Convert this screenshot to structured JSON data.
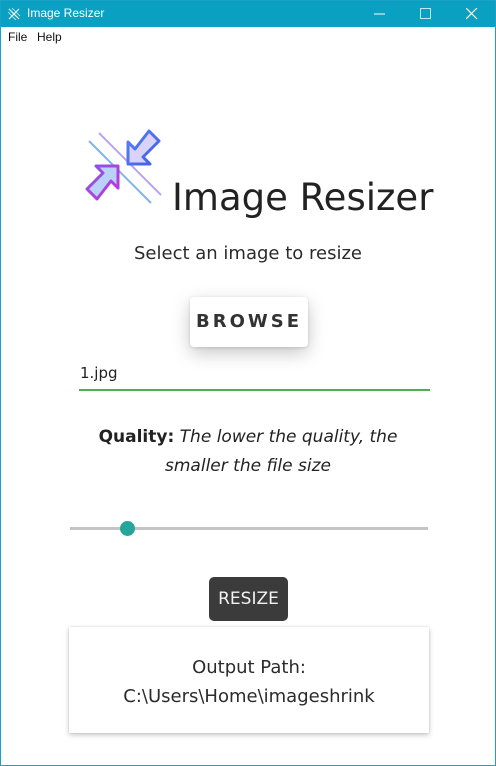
{
  "window": {
    "title": "Image Resizer",
    "accent_color": "#0aa0c2",
    "icons": [
      "app-icon",
      "minimize-icon",
      "maximize-icon",
      "close-icon"
    ]
  },
  "menubar": {
    "file_label": "File",
    "help_label": "Help"
  },
  "header": {
    "logo_icon": "resize-arrows-icon",
    "title": "Image Resizer",
    "subtitle": "Select an image to resize"
  },
  "browse": {
    "label": "BROWSE"
  },
  "file_input": {
    "value": "1.jpg",
    "underline_color": "#4caf50"
  },
  "quality": {
    "label": "Quality:",
    "description": "The lower the quality, the smaller the file size",
    "slider_value_percent": 16,
    "slider_color": "#26a69a"
  },
  "resize": {
    "label": "RESIZE"
  },
  "output": {
    "label": "Output Path:",
    "path": "C:\\Users\\Home\\imageshrink"
  }
}
